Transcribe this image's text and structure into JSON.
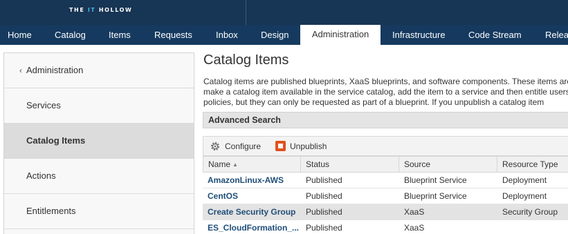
{
  "header": {
    "logo_prefix": "THE ",
    "logo_highlight": "IT",
    "logo_suffix": " HOLLOW"
  },
  "nav": {
    "tabs": [
      {
        "label": "Home"
      },
      {
        "label": "Catalog"
      },
      {
        "label": "Items"
      },
      {
        "label": "Requests"
      },
      {
        "label": "Inbox"
      },
      {
        "label": "Design"
      },
      {
        "label": "Administration",
        "active": true
      },
      {
        "label": "Infrastructure"
      },
      {
        "label": "Code Stream"
      },
      {
        "label": "Release"
      }
    ]
  },
  "sidebar": {
    "back_icon": "chevron-left-icon",
    "back_label": "Administration",
    "items": [
      {
        "label": "Services"
      },
      {
        "label": "Catalog Items",
        "selected": true
      },
      {
        "label": "Actions"
      },
      {
        "label": "Entitlements"
      }
    ]
  },
  "main": {
    "title": "Catalog Items",
    "description_lines": [
      "Catalog items are published blueprints, XaaS blueprints, and software components. These items are available for use. To",
      "make a catalog item available in the service catalog, add the item to a service and then entitle users to it. Software components are subject to",
      "policies, but they can only be requested as part of a blueprint. If you unpublish a catalog item"
    ],
    "advanced_search_label": "Advanced Search",
    "toolbar": {
      "configure_label": "Configure",
      "configure_icon": "gear-icon",
      "unpublish_label": "Unpublish",
      "unpublish_icon": "stop-icon"
    },
    "table": {
      "columns": [
        "Name",
        "Status",
        "Source",
        "Resource Type"
      ],
      "sort_icon": "sort-ascending-icon",
      "rows": [
        {
          "name": "AmazonLinux-AWS",
          "status": "Published",
          "source": "Blueprint Service",
          "resource_type": "Deployment"
        },
        {
          "name": "CentOS",
          "status": "Published",
          "source": "Blueprint Service",
          "resource_type": "Deployment"
        },
        {
          "name": "Create Security Group",
          "status": "Published",
          "source": "XaaS",
          "resource_type": "Security Group",
          "selected": true
        },
        {
          "name": "ES_CloudFormation_...",
          "status": "Published",
          "source": "XaaS",
          "resource_type": ""
        }
      ]
    }
  }
}
